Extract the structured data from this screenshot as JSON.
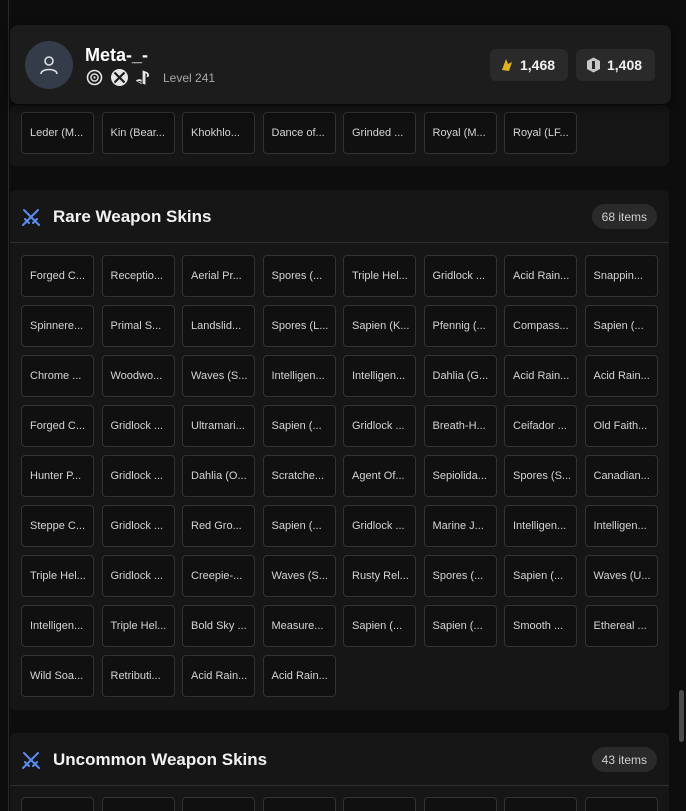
{
  "profile": {
    "username": "Meta-_-",
    "level_text": "Level 241",
    "platforms": [
      "ubisoft-icon",
      "xbox-icon",
      "playstation-icon"
    ],
    "currencies": [
      {
        "icon": "renown-icon",
        "value": "1,468"
      },
      {
        "icon": "r6-credits-icon",
        "value": "1,408"
      }
    ]
  },
  "top_section": {
    "items": [
      "Leder (M...",
      "Kin (Bear...",
      "Khokhlo...",
      "Dance of...",
      "Grinded ...",
      "Royal (M...",
      "Royal (LF..."
    ]
  },
  "rare_section": {
    "title": "Rare Weapon Skins",
    "count": "68 items",
    "items": [
      "Forged C...",
      "Receptio...",
      "Aerial Pr...",
      "Spores (...",
      "Triple Hel...",
      "Gridlock ...",
      "Acid Rain...",
      "Snappin...",
      "Spinnere...",
      "Primal S...",
      "Landslid...",
      "Spores (L...",
      "Sapien (K...",
      "Pfennig (...",
      "Compass...",
      "Sapien (...",
      "Chrome ...",
      "Woodwo...",
      "Waves (S...",
      "Intelligen...",
      "Intelligen...",
      "Dahlia (G...",
      "Acid Rain...",
      "Acid Rain...",
      "Forged C...",
      "Gridlock ...",
      "Ultramari...",
      "Sapien (...",
      "Gridlock ...",
      "Breath-H...",
      "Ceifador ...",
      "Old Faith...",
      "Hunter P...",
      "Gridlock ...",
      "Dahlia (O...",
      "Scratche...",
      "Agent Of...",
      "Sepiolida...",
      "Spores (S...",
      "Canadian...",
      "Steppe C...",
      "Gridlock ...",
      "Red Gro...",
      "Sapien (...",
      "Gridlock ...",
      "Marine J...",
      "Intelligen...",
      "Intelligen...",
      "Triple Hel...",
      "Gridlock ...",
      "Creepie-...",
      "Waves (S...",
      "Rusty Rel...",
      "Spores (...",
      "Sapien (...",
      "Waves (U...",
      "Intelligen...",
      "Triple Hel...",
      "Bold Sky ...",
      "Measure...",
      "Sapien (...",
      "Sapien (...",
      "Smooth ...",
      "Ethereal ...",
      "Wild Soa...",
      "Retributi...",
      "Acid Rain...",
      "Acid Rain..."
    ]
  },
  "uncommon_section": {
    "title": "Uncommon Weapon Skins",
    "count": "43 items"
  },
  "colors": {
    "accent_icon": "#5b8cf0",
    "background": "#0d0d0d",
    "panel": "#161616"
  }
}
